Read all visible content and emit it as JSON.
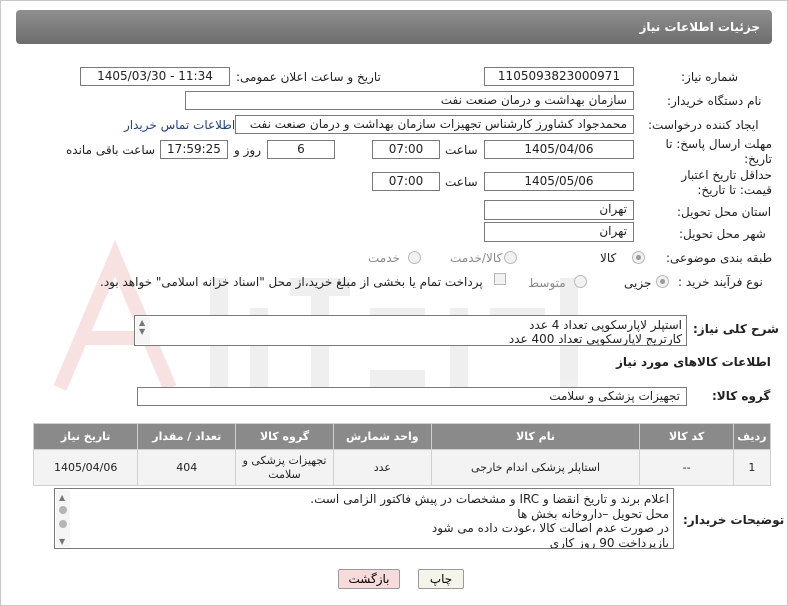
{
  "header": {
    "title": "جزئیات اطلاعات نیاز"
  },
  "form": {
    "need_number": {
      "label": "شماره نیاز:",
      "value": "1105093823000971"
    },
    "announce_datetime": {
      "label": "تاریخ و ساعت اعلان عمومی:",
      "value": "1405/03/30 - 11:34"
    },
    "buyer_org": {
      "label": "نام دستگاه خریدار:",
      "value": "سازمان بهداشت و درمان صنعت نفت"
    },
    "requester": {
      "label": "ایجاد کننده درخواست:",
      "value": "محمدجواد کشاورز کارشناس تجهیزات سازمان بهداشت و درمان صنعت نفت",
      "contact_link": "اطلاعات تماس خریدار"
    },
    "reply_deadline": {
      "label": "مهلت ارسال پاسخ: تا تاریخ:",
      "date": "1405/04/06",
      "time_label": "ساعت",
      "time": "07:00",
      "days": "6",
      "days_label": "روز و",
      "remaining": "17:59:25",
      "remaining_label": "ساعت باقی مانده"
    },
    "price_validity": {
      "label": "حداقل تاریخ اعتبار قیمت: تا تاریخ:",
      "date": "1405/05/06",
      "time_label": "ساعت",
      "time": "07:00"
    },
    "delivery_province": {
      "label": "استان محل تحویل:",
      "value": "تهران"
    },
    "delivery_city": {
      "label": "شهر محل تحویل:",
      "value": "تهران"
    },
    "category": {
      "label": "طبقه بندی موضوعی:",
      "options": [
        "کالا",
        "کالا/خدمت",
        "خدمت"
      ]
    },
    "purchase_process": {
      "label": "نوع فرآیند خرید :",
      "options": [
        "جزیی",
        "متوسط"
      ],
      "payment_note": "پرداخت تمام یا بخشی از مبلغ خرید،از محل \"اسناد خزانه اسلامی\" خواهد بود."
    }
  },
  "general_description": {
    "label": "شرح کلی نیاز:",
    "lines": [
      "استپلر لاپارسکوپی تعداد 4 عدد",
      "کارتریج لاپارسکوپی تعداد 400 عدد"
    ]
  },
  "goods_info": {
    "title": "اطلاعات کالاهای مورد نیاز",
    "group_label": "گروه کالا:",
    "group_value": "تجهیزات پزشکی و سلامت"
  },
  "table": {
    "headers": [
      "ردیف",
      "کد کالا",
      "نام کالا",
      "واحد شمارش",
      "گروه کالا",
      "تعداد / مقدار",
      "تاریخ نیاز"
    ],
    "rows": [
      [
        "1",
        "--",
        "استاپلر پزشکی اندام خارجی",
        "عدد",
        "تجهیزات پزشکی و سلامت",
        "404",
        "1405/04/06"
      ]
    ]
  },
  "buyer_notes": {
    "label": "توضیحات خریدار:",
    "lines": [
      "اعلام برند و تاریخ انقضا  و IRC  و مشخصات در پیش فاکتور الزامی است.",
      "محل تحویل –داروخانه بخش ها",
      "در صورت عدم اصالت کالا ،عودت داده می شود",
      "بازپرداخت 90 روز کاری"
    ]
  },
  "buttons": {
    "print": "چاپ",
    "back": "بازگشت"
  },
  "colors": {
    "header_bg": "#7a7a7a",
    "print_bg": "#f4f4e8",
    "back_bg": "#f7dada",
    "link": "#1f3f8f"
  }
}
